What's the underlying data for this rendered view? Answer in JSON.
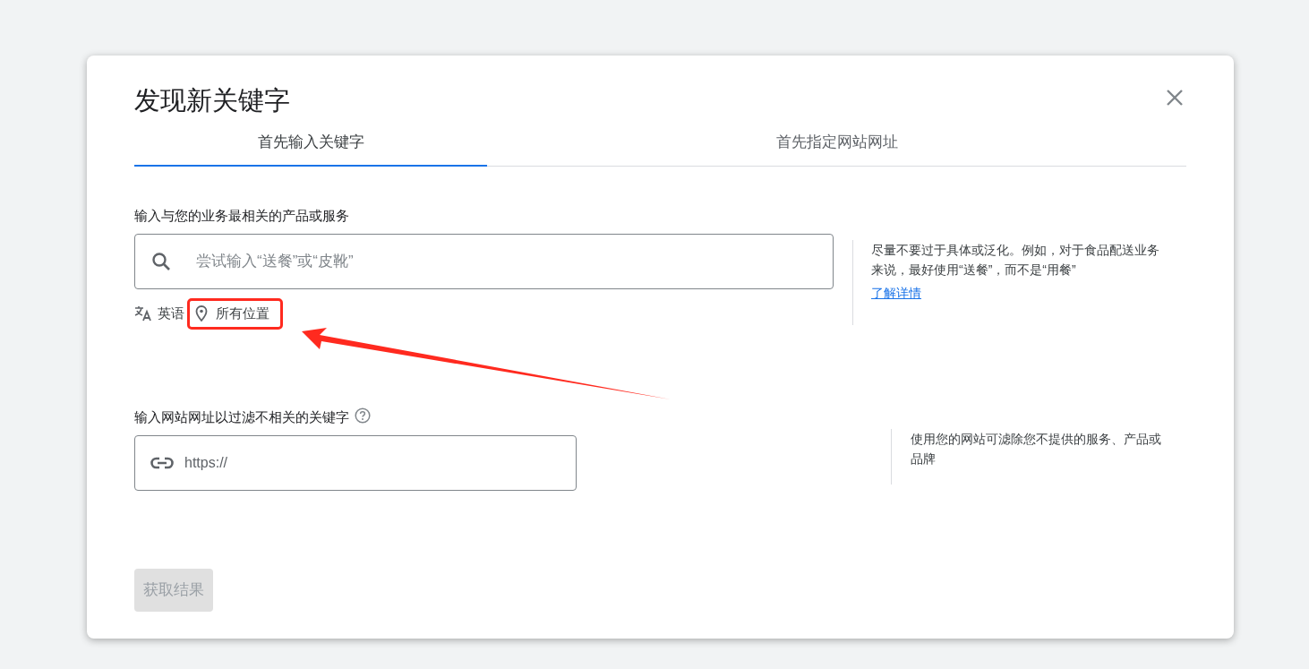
{
  "dialog": {
    "title": "发现新关键字"
  },
  "tabs": [
    {
      "label": "首先输入关键字",
      "selected": true
    },
    {
      "label": "首先指定网站网址",
      "selected": false
    }
  ],
  "keyword_section": {
    "label": "输入与您的业务最相关的产品或服务",
    "placeholder": "尝试输入“送餐”或“皮靴”",
    "language": "英语",
    "location": "所有位置",
    "location_highlighted": true,
    "hint": "尽量不要过于具体或泛化。例如，对于食品配送业务来说，最好使用“送餐”，而不是“用餐”",
    "hint_link": "了解详情"
  },
  "website_section": {
    "label": "输入网站网址以过滤不相关的关键字",
    "placeholder": "https://",
    "hint": "使用您的网站可滤除您不提供的服务、产品或品牌"
  },
  "submit_button": {
    "label": "获取结果",
    "disabled": true
  }
}
